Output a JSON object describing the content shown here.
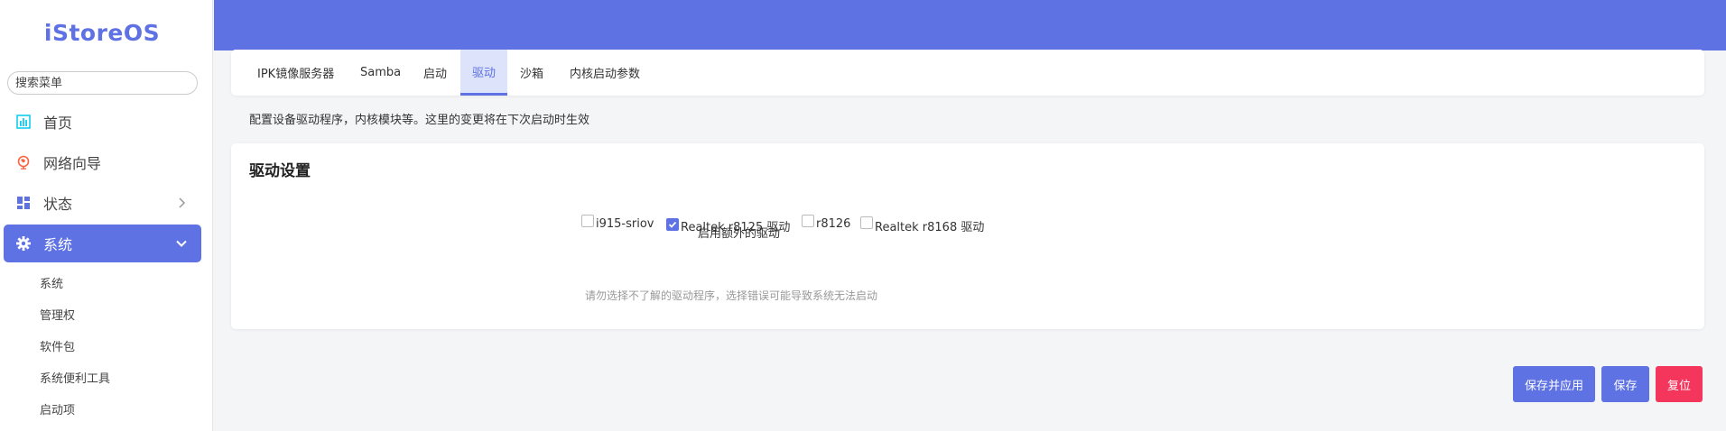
{
  "sidebar": {
    "logo": "iStoreOS",
    "search_placeholder": "搜索菜单",
    "items": [
      {
        "label": "首页"
      },
      {
        "label": "网络向导"
      },
      {
        "label": "状态"
      },
      {
        "label": "系统"
      }
    ],
    "sub_items": [
      "系统",
      "管理权",
      "软件包",
      "系统便利工具",
      "启动项"
    ]
  },
  "tabs": [
    "IPK镜像服务器",
    "Samba",
    "启动",
    "驱动",
    "沙箱",
    "内核启动参数"
  ],
  "active_tab": "驱动",
  "description": "配置设备驱动程序，内核模块等。这里的变更将在下次启动时生效",
  "section": {
    "title": "驱动设置",
    "field_label": "启用额外的驱动",
    "options": [
      {
        "label": "i915-sriov",
        "checked": false
      },
      {
        "label": "Realtek r8125 驱动",
        "checked": true
      },
      {
        "label": "r8126",
        "checked": false
      },
      {
        "label": "Realtek r8168 驱动",
        "checked": false
      }
    ],
    "hint": "请勿选择不了解的驱动程序，选择错误可能导致系统无法启动"
  },
  "buttons": {
    "apply": "保存并应用",
    "save": "保存",
    "reset": "复位"
  },
  "colors": {
    "accent": "#5e72e4",
    "danger": "#f5365c"
  }
}
